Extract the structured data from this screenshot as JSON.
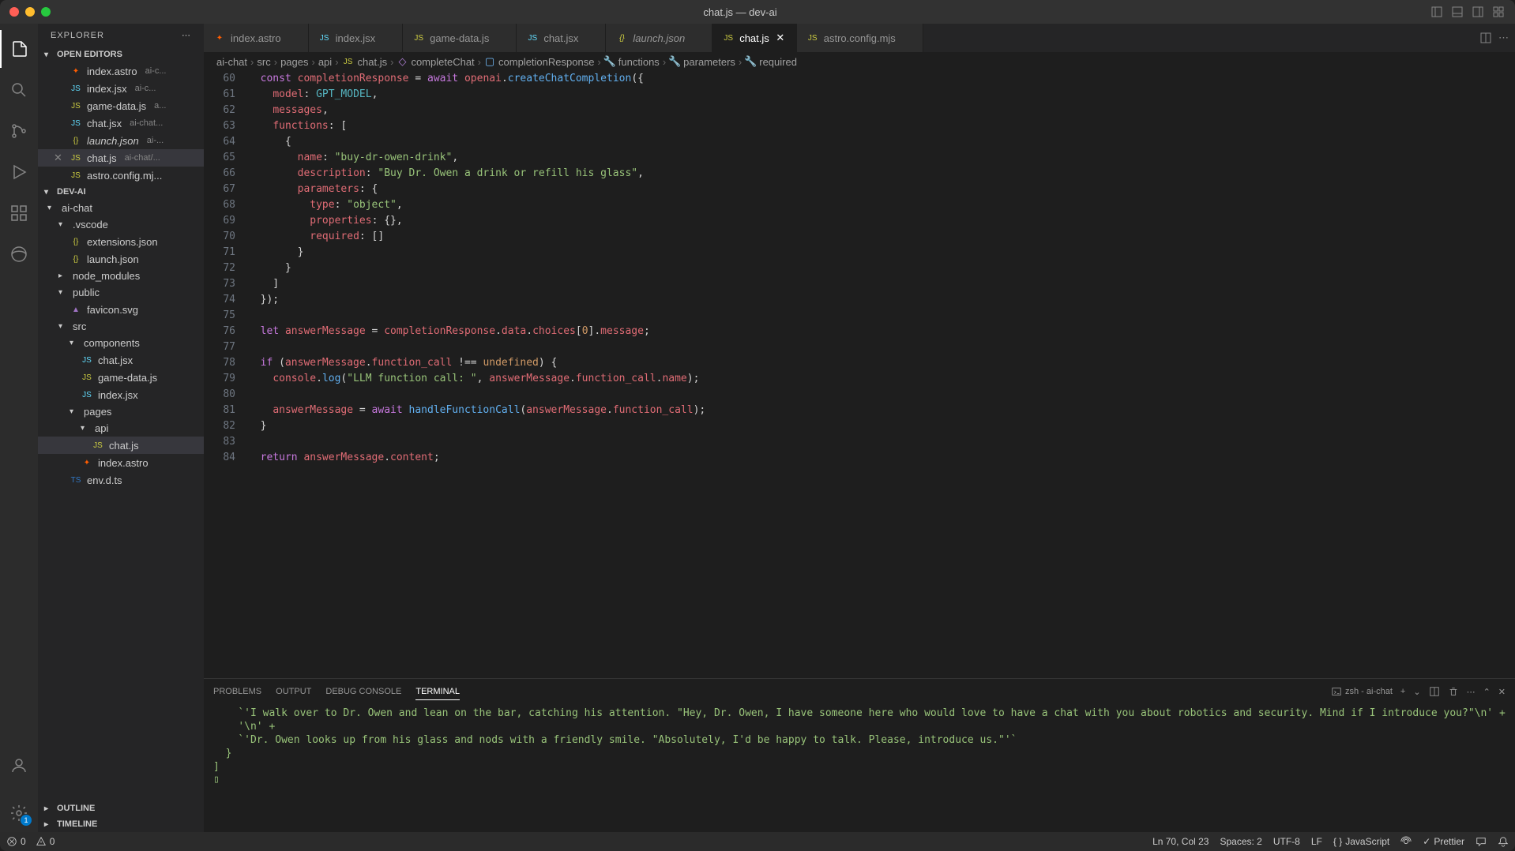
{
  "window": {
    "title": "chat.js — dev-ai"
  },
  "sidebar": {
    "title": "EXPLORER",
    "sections": {
      "open_editors": "OPEN EDITORS",
      "project": "DEV-AI",
      "outline": "OUTLINE",
      "timeline": "TIMELINE"
    },
    "open_editors": [
      {
        "name": "index.astro",
        "path": "ai-c...",
        "icon": "astro"
      },
      {
        "name": "index.jsx",
        "path": "ai-c...",
        "icon": "jsx"
      },
      {
        "name": "game-data.js",
        "path": "a...",
        "icon": "js"
      },
      {
        "name": "chat.jsx",
        "path": "ai-chat...",
        "icon": "jsx"
      },
      {
        "name": "launch.json",
        "path": "ai-...",
        "icon": "json",
        "italic": true
      },
      {
        "name": "chat.js",
        "path": "ai-chat/...",
        "icon": "js",
        "active": true
      },
      {
        "name": "astro.config.mj...",
        "path": "",
        "icon": "js"
      }
    ],
    "tree": [
      {
        "name": "ai-chat",
        "type": "folder",
        "depth": 0
      },
      {
        "name": ".vscode",
        "type": "folder",
        "depth": 1
      },
      {
        "name": "extensions.json",
        "type": "file",
        "icon": "json",
        "depth": 2
      },
      {
        "name": "launch.json",
        "type": "file",
        "icon": "json",
        "depth": 2
      },
      {
        "name": "node_modules",
        "type": "folder",
        "depth": 1,
        "collapsed": true
      },
      {
        "name": "public",
        "type": "folder",
        "depth": 1
      },
      {
        "name": "favicon.svg",
        "type": "file",
        "icon": "svg",
        "depth": 2
      },
      {
        "name": "src",
        "type": "folder",
        "depth": 1
      },
      {
        "name": "components",
        "type": "folder",
        "depth": 2
      },
      {
        "name": "chat.jsx",
        "type": "file",
        "icon": "jsx",
        "depth": 3
      },
      {
        "name": "game-data.js",
        "type": "file",
        "icon": "js",
        "depth": 3
      },
      {
        "name": "index.jsx",
        "type": "file",
        "icon": "jsx",
        "depth": 3
      },
      {
        "name": "pages",
        "type": "folder",
        "depth": 2
      },
      {
        "name": "api",
        "type": "folder",
        "depth": 3
      },
      {
        "name": "chat.js",
        "type": "file",
        "icon": "js",
        "depth": 4,
        "active": true
      },
      {
        "name": "index.astro",
        "type": "file",
        "icon": "astro",
        "depth": 3
      },
      {
        "name": "env.d.ts",
        "type": "file",
        "icon": "ts",
        "depth": 2
      }
    ]
  },
  "tabs": [
    {
      "label": "index.astro",
      "icon": "astro"
    },
    {
      "label": "index.jsx",
      "icon": "jsx"
    },
    {
      "label": "game-data.js",
      "icon": "js"
    },
    {
      "label": "chat.jsx",
      "icon": "jsx"
    },
    {
      "label": "launch.json",
      "icon": "json",
      "italic": true
    },
    {
      "label": "chat.js",
      "icon": "js",
      "active": true
    },
    {
      "label": "astro.config.mjs",
      "icon": "js"
    }
  ],
  "breadcrumbs": [
    {
      "label": "ai-chat"
    },
    {
      "label": "src"
    },
    {
      "label": "pages"
    },
    {
      "label": "api"
    },
    {
      "label": "chat.js",
      "icon": "js"
    },
    {
      "label": "completeChat",
      "icon": "method"
    },
    {
      "label": "completionResponse",
      "icon": "var"
    },
    {
      "label": "functions",
      "icon": "prop"
    },
    {
      "label": "parameters",
      "icon": "prop"
    },
    {
      "label": "required",
      "icon": "prop"
    }
  ],
  "editor": {
    "first_line": 60,
    "lines": [
      {
        "n": 60,
        "tokens": [
          [
            "  ",
            ""
          ],
          [
            "const",
            "keyword"
          ],
          [
            " ",
            ""
          ],
          [
            "completionResponse",
            "var"
          ],
          [
            " = ",
            ""
          ],
          [
            "await",
            "await"
          ],
          [
            " ",
            ""
          ],
          [
            "openai",
            "var"
          ],
          [
            ".",
            ""
          ],
          [
            "createChatCompletion",
            "func"
          ],
          [
            "({",
            ""
          ]
        ]
      },
      {
        "n": 61,
        "tokens": [
          [
            "    ",
            ""
          ],
          [
            "model",
            "prop"
          ],
          [
            ": ",
            ""
          ],
          [
            "GPT_MODEL",
            "const"
          ],
          [
            ",",
            ""
          ]
        ]
      },
      {
        "n": 62,
        "tokens": [
          [
            "    ",
            ""
          ],
          [
            "messages",
            "prop"
          ],
          [
            ",",
            ""
          ]
        ]
      },
      {
        "n": 63,
        "tokens": [
          [
            "    ",
            ""
          ],
          [
            "functions",
            "prop"
          ],
          [
            ": [",
            ""
          ]
        ]
      },
      {
        "n": 64,
        "tokens": [
          [
            "      {",
            ""
          ]
        ]
      },
      {
        "n": 65,
        "tokens": [
          [
            "        ",
            ""
          ],
          [
            "name",
            "prop"
          ],
          [
            ": ",
            ""
          ],
          [
            "\"buy-dr-owen-drink\"",
            "string"
          ],
          [
            ",",
            ""
          ]
        ]
      },
      {
        "n": 66,
        "tokens": [
          [
            "        ",
            ""
          ],
          [
            "description",
            "prop"
          ],
          [
            ": ",
            ""
          ],
          [
            "\"Buy Dr. Owen a drink or refill his glass\"",
            "string"
          ],
          [
            ",",
            ""
          ]
        ]
      },
      {
        "n": 67,
        "tokens": [
          [
            "        ",
            ""
          ],
          [
            "parameters",
            "prop"
          ],
          [
            ": {",
            ""
          ]
        ]
      },
      {
        "n": 68,
        "tokens": [
          [
            "          ",
            ""
          ],
          [
            "type",
            "prop"
          ],
          [
            ": ",
            ""
          ],
          [
            "\"object\"",
            "string"
          ],
          [
            ",",
            ""
          ]
        ]
      },
      {
        "n": 69,
        "tokens": [
          [
            "          ",
            ""
          ],
          [
            "properties",
            "prop"
          ],
          [
            ": {},",
            ""
          ]
        ]
      },
      {
        "n": 70,
        "tokens": [
          [
            "          ",
            ""
          ],
          [
            "required",
            "prop"
          ],
          [
            ": []",
            ""
          ]
        ]
      },
      {
        "n": 71,
        "tokens": [
          [
            "        }",
            ""
          ]
        ]
      },
      {
        "n": 72,
        "tokens": [
          [
            "      }",
            ""
          ]
        ]
      },
      {
        "n": 73,
        "tokens": [
          [
            "    ]",
            ""
          ]
        ]
      },
      {
        "n": 74,
        "tokens": [
          [
            "  });",
            ""
          ]
        ]
      },
      {
        "n": 75,
        "tokens": [
          [
            "",
            ""
          ]
        ]
      },
      {
        "n": 76,
        "tokens": [
          [
            "  ",
            ""
          ],
          [
            "let",
            "keyword"
          ],
          [
            " ",
            ""
          ],
          [
            "answerMessage",
            "var"
          ],
          [
            " = ",
            ""
          ],
          [
            "completionResponse",
            "var"
          ],
          [
            ".",
            ""
          ],
          [
            "data",
            "prop"
          ],
          [
            ".",
            ""
          ],
          [
            "choices",
            "prop"
          ],
          [
            "[",
            ""
          ],
          [
            "0",
            "number"
          ],
          [
            "].",
            ""
          ],
          [
            "message",
            "prop"
          ],
          [
            ";",
            ""
          ]
        ]
      },
      {
        "n": 77,
        "tokens": [
          [
            "",
            ""
          ]
        ]
      },
      {
        "n": 78,
        "tokens": [
          [
            "  ",
            ""
          ],
          [
            "if",
            "keyword"
          ],
          [
            " (",
            ""
          ],
          [
            "answerMessage",
            "var"
          ],
          [
            ".",
            ""
          ],
          [
            "function_call",
            "prop"
          ],
          [
            " !== ",
            ""
          ],
          [
            "undefined",
            "undef"
          ],
          [
            ") {",
            ""
          ]
        ]
      },
      {
        "n": 79,
        "tokens": [
          [
            "    ",
            ""
          ],
          [
            "console",
            "var"
          ],
          [
            ".",
            ""
          ],
          [
            "log",
            "func"
          ],
          [
            "(",
            ""
          ],
          [
            "\"LLM function call: \"",
            "string"
          ],
          [
            ", ",
            ""
          ],
          [
            "answerMessage",
            "var"
          ],
          [
            ".",
            ""
          ],
          [
            "function_call",
            "prop"
          ],
          [
            ".",
            ""
          ],
          [
            "name",
            "prop"
          ],
          [
            ");",
            ""
          ]
        ]
      },
      {
        "n": 80,
        "tokens": [
          [
            "",
            ""
          ]
        ]
      },
      {
        "n": 81,
        "tokens": [
          [
            "    ",
            ""
          ],
          [
            "answerMessage",
            "var"
          ],
          [
            " = ",
            ""
          ],
          [
            "await",
            "await"
          ],
          [
            " ",
            ""
          ],
          [
            "handleFunctionCall",
            "func"
          ],
          [
            "(",
            ""
          ],
          [
            "answerMessage",
            "var"
          ],
          [
            ".",
            ""
          ],
          [
            "function_call",
            "prop"
          ],
          [
            ");",
            ""
          ]
        ]
      },
      {
        "n": 82,
        "tokens": [
          [
            "  }",
            ""
          ]
        ]
      },
      {
        "n": 83,
        "tokens": [
          [
            "",
            ""
          ]
        ]
      },
      {
        "n": 84,
        "tokens": [
          [
            "  ",
            ""
          ],
          [
            "return",
            "keyword"
          ],
          [
            " ",
            ""
          ],
          [
            "answerMessage",
            "var"
          ],
          [
            ".",
            ""
          ],
          [
            "content",
            "prop"
          ],
          [
            ";",
            ""
          ]
        ]
      }
    ]
  },
  "panel": {
    "tabs": [
      "PROBLEMS",
      "OUTPUT",
      "DEBUG CONSOLE",
      "TERMINAL"
    ],
    "active_tab": "TERMINAL",
    "shell": "zsh - ai-chat",
    "output": [
      "    `'I walk over to Dr. Owen and lean on the bar, catching his attention. \"Hey, Dr. Owen, I have someone here who would love to have a chat with you about robotics and security. Mind if I introduce you?\"\\n' +",
      "    '\\n' +",
      "    `'Dr. Owen looks up from his glass and nods with a friendly smile. \"Absolutely, I'd be happy to talk. Please, introduce us.\"'`",
      "  }",
      "]",
      "▯"
    ]
  },
  "statusbar": {
    "errors": "0",
    "warnings": "0",
    "position": "Ln 70, Col 23",
    "spaces": "Spaces: 2",
    "encoding": "UTF-8",
    "eol": "LF",
    "language": "JavaScript",
    "prettier": "Prettier"
  }
}
